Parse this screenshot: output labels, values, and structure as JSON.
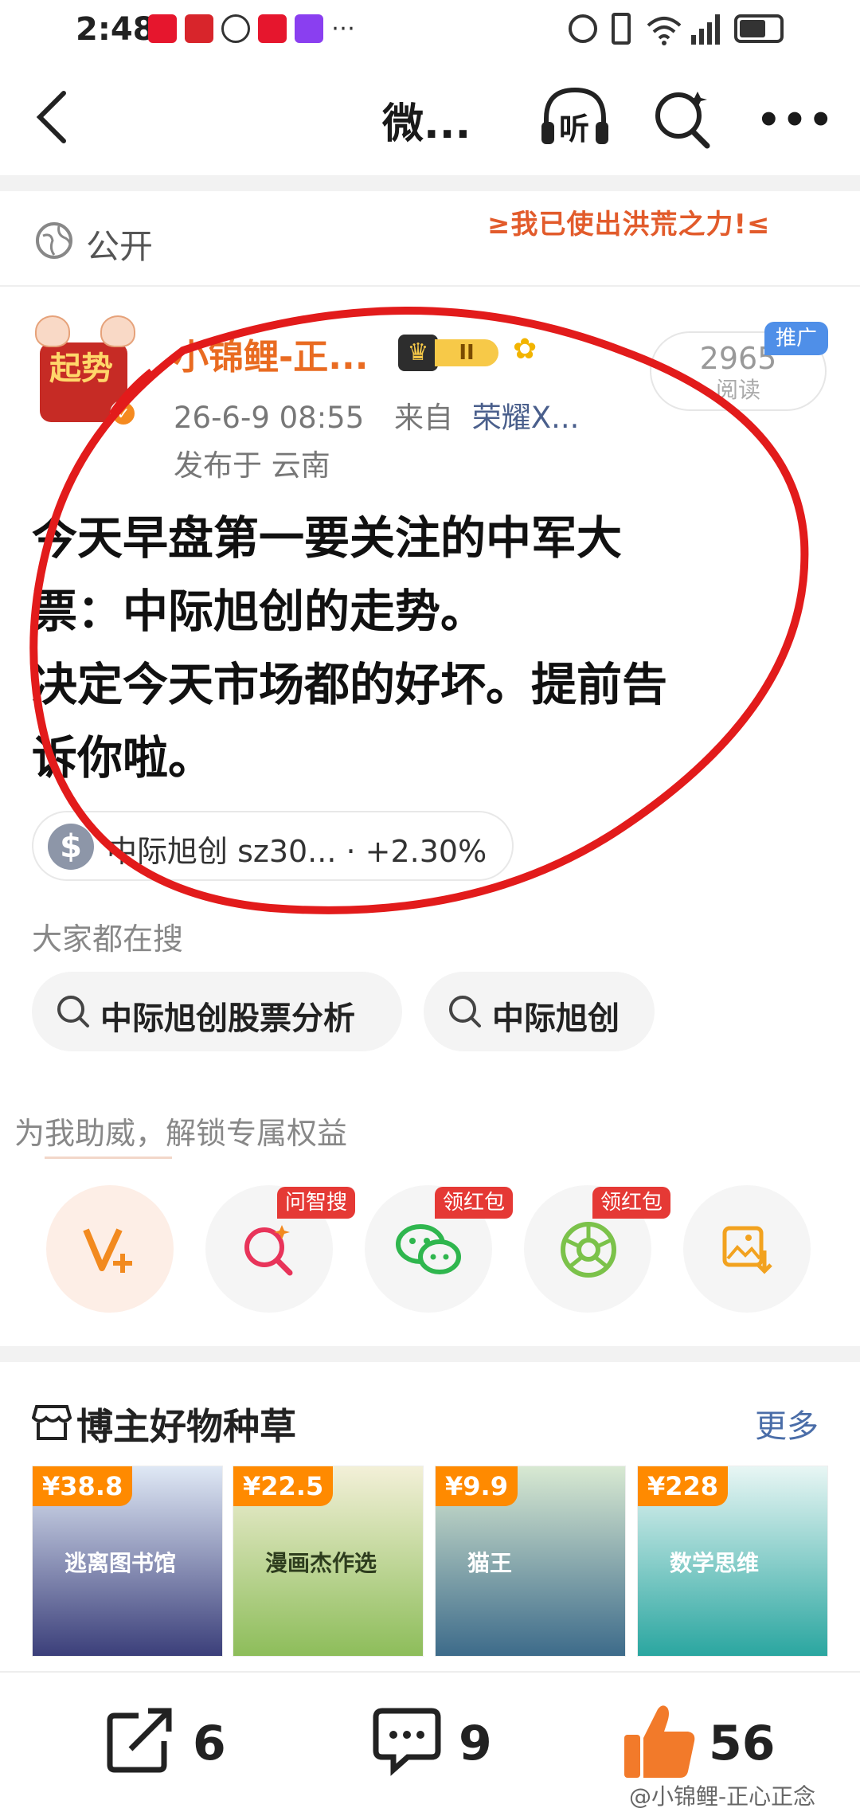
{
  "status_bar": {
    "time": "2:48"
  },
  "nav": {
    "title": "微...",
    "listen_label": "听"
  },
  "visibility": {
    "label": "公开",
    "banner": "≥我已使出洪荒之力!≤"
  },
  "post": {
    "username": "小锦鲤-正...",
    "avatar_text": "起势",
    "level": "II",
    "meta_time": "26-6-9 08:55",
    "meta_from": "来自",
    "meta_device": "荣耀X...",
    "location": "发布于 云南",
    "reads_count": "2965",
    "reads_label": "阅读",
    "promo_label": "推广",
    "content": "今天早盘第一要关注的中军大\n票：中际旭创的走势。\n决定今天市场都的好坏。提前告\n诉你啦。",
    "stock_chip": "中际旭创 sz30... · +2.30%"
  },
  "search": {
    "title": "大家都在搜",
    "chips": [
      "中际旭创股票分析",
      "中际旭创"
    ]
  },
  "cheer": {
    "title": "为我助威，解锁专属权益",
    "tags": [
      "问智搜",
      "领红包",
      "领红包"
    ]
  },
  "goods": {
    "title": "博主好物种草",
    "more": "更多",
    "products": [
      {
        "price": "¥38.8",
        "label": "逃离图书馆",
        "color": "#3b3f7a"
      },
      {
        "price": "¥22.5",
        "label": "漫画杰作选",
        "color": "#8dbd5a"
      },
      {
        "price": "¥9.9",
        "label": "猫王",
        "color": "#3d6b8a"
      },
      {
        "price": "¥228",
        "label": "数学思维",
        "color": "#2aa6a0"
      }
    ]
  },
  "bottom_bar": {
    "share_count": "6",
    "comment_count": "9",
    "like_count": "56",
    "watermark": "@小锦鲤-正心正念"
  }
}
